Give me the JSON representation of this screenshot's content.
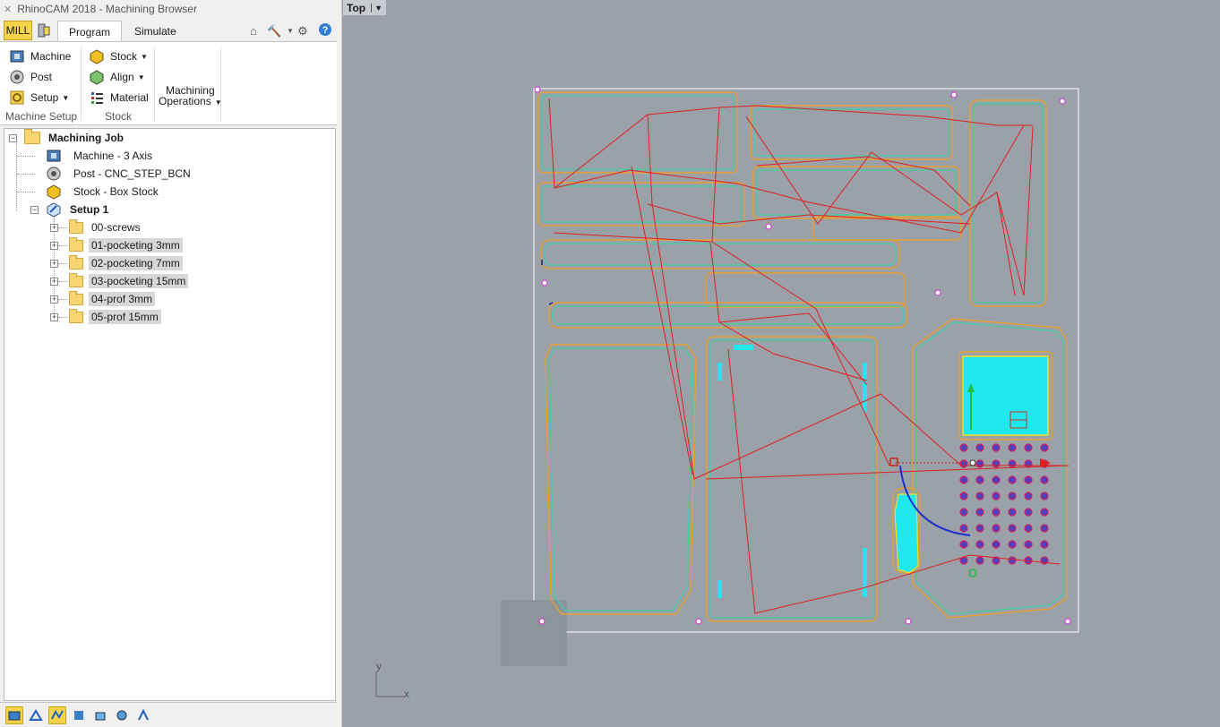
{
  "window": {
    "title": "RhinoCAM 2018 - Machining Browser"
  },
  "ribbon": {
    "mill_label": "MILL",
    "tabs": [
      "Program",
      "Simulate"
    ],
    "machine_setup": {
      "machine": "Machine",
      "post": "Post",
      "setup": "Setup",
      "group_label": "Machine Setup"
    },
    "stock": {
      "stock": "Stock",
      "align": "Align",
      "material": "Material",
      "group_label": "Stock"
    },
    "machining_ops": {
      "line1": "Machining",
      "line2": "Operations"
    }
  },
  "tree": {
    "root": "Machining Job",
    "machine": "Machine - 3 Axis",
    "post": "Post - CNC_STEP_BCN",
    "stock": "Stock - Box Stock",
    "setup": "Setup 1",
    "folders": [
      "00-screws",
      "01-pocketing 3mm",
      "02-pocketing 7mm",
      "03-pocketing 15mm",
      "04-prof 3mm",
      "05-prof 15mm"
    ]
  },
  "viewport": {
    "name": "Top",
    "axis_x": "x",
    "axis_y": "y"
  },
  "colors": {
    "accent": "#f5d44c",
    "toolpath": "#e02020",
    "contour_orange": "#f0a020",
    "contour_green": "#40d0a0",
    "pocket": "#20e8f0",
    "background": "#9aa1a9"
  }
}
